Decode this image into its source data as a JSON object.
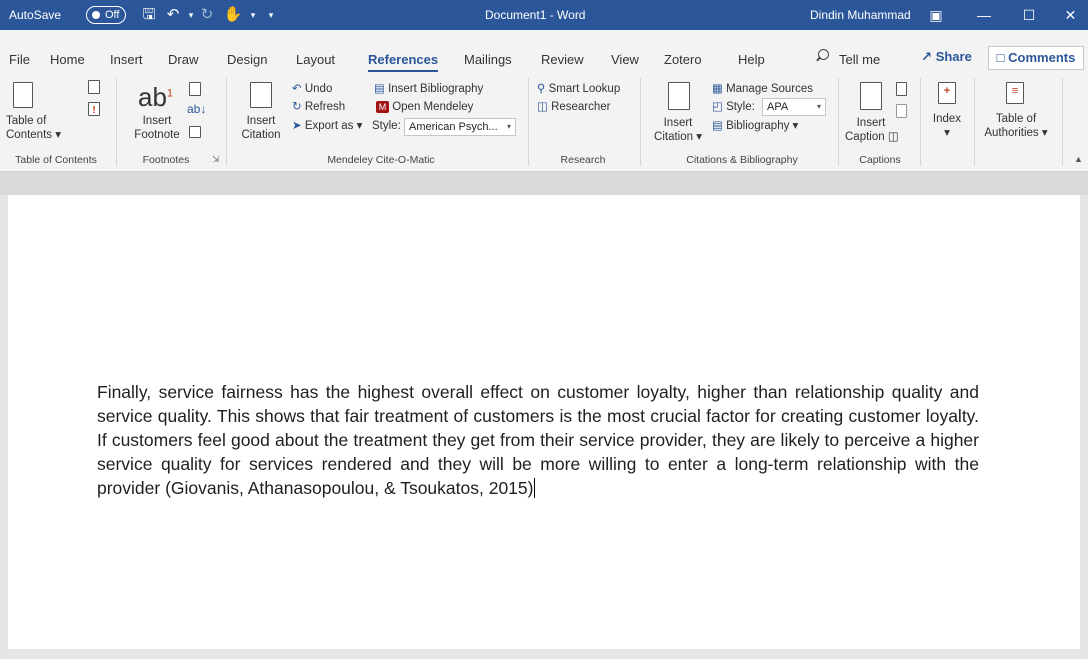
{
  "titlebar": {
    "autosave_label": "AutoSave",
    "autosave_state": "Off",
    "document_title": "Document1 - Word",
    "user_name": "Dindin Muhammad",
    "window_controls": [
      "ribbon-display-options-icon",
      "minimize-icon",
      "maximize-icon",
      "close-icon"
    ]
  },
  "tabs": {
    "items": [
      "File",
      "Home",
      "Insert",
      "Draw",
      "Design",
      "Layout",
      "References",
      "Mailings",
      "Review",
      "View",
      "Zotero",
      "Help"
    ],
    "active": "References",
    "tell_me": "Tell me",
    "share": "Share",
    "comments": "Comments"
  },
  "ribbon": {
    "toc": {
      "button_line1": "Table of",
      "button_line2": "Contents",
      "group_label": "Table of Contents"
    },
    "footnotes": {
      "insert_line1": "Insert",
      "insert_line2": "Footnote",
      "ab_glyph": "ab",
      "superscript": "1",
      "group_label": "Footnotes"
    },
    "mendeley": {
      "insert_citation_line1": "Insert",
      "insert_citation_line2": "Citation",
      "undo": "Undo",
      "refresh": "Refresh",
      "export_as": "Export as",
      "insert_bibliography": "Insert Bibliography",
      "open_mendeley": "Open Mendeley",
      "style_label": "Style:",
      "style_value": "American Psych...",
      "group_label": "Mendeley Cite-O-Matic"
    },
    "research": {
      "smart_lookup": "Smart Lookup",
      "researcher": "Researcher",
      "group_label": "Research"
    },
    "citations": {
      "insert_citation_line1": "Insert",
      "insert_citation_line2": "Citation",
      "manage_sources": "Manage Sources",
      "style_label": "Style:",
      "style_value": "APA",
      "bibliography": "Bibliography",
      "group_label": "Citations & Bibliography"
    },
    "captions": {
      "insert_caption_line1": "Insert",
      "insert_caption_line2": "Caption",
      "group_label": "Captions"
    },
    "index": {
      "label": "Index"
    },
    "authorities": {
      "line1": "Table of",
      "line2": "Authorities"
    }
  },
  "document": {
    "paragraph": "Finally, service fairness has the highest overall effect on customer loyalty, higher than relationship quality and service quality. This shows that fair treatment of customers is the most crucial factor for creating customer loyalty. If customers feel good about the treatment they get from their service provider, they are likely to perceive a higher service quality for services rendered and they will be more willing to enter a long-term relationship with the provider (Giovanis, Athanasopoulou, & Tsoukatos, 2015)"
  },
  "colors": {
    "accent": "#2b579a",
    "ribbon_bg": "#f3f3f3",
    "page_bg": "#ffffff",
    "mendeley_red": "#a31515"
  }
}
